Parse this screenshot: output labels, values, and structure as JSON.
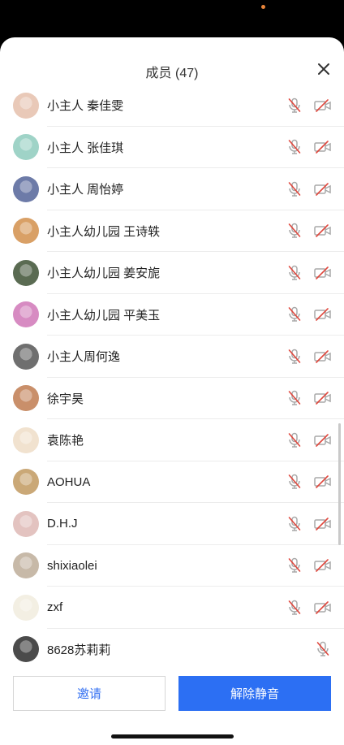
{
  "sheet": {
    "title": "成员 (47)",
    "close_icon": "close-icon"
  },
  "members": [
    {
      "name": "小主人 秦佳雯",
      "avatar_color": "#e9c9b8",
      "mic": "muted",
      "camera": "off"
    },
    {
      "name": "小主人 张佳琪",
      "avatar_color": "#9fd3c7",
      "mic": "muted",
      "camera": "off"
    },
    {
      "name": "小主人 周怡婷",
      "avatar_color": "#6d7ba8",
      "mic": "muted",
      "camera": "off"
    },
    {
      "name": "小主人幼儿园  王诗轶",
      "avatar_color": "#d9a066",
      "mic": "muted",
      "camera": "off"
    },
    {
      "name": "小主人幼儿园 姜安旎",
      "avatar_color": "#5a6b52",
      "mic": "muted",
      "camera": "off"
    },
    {
      "name": "小主人幼儿园 平美玉",
      "avatar_color": "#d78bc2",
      "mic": "muted",
      "camera": "off"
    },
    {
      "name": "小主人周何逸",
      "avatar_color": "#6f6f6f",
      "mic": "muted",
      "camera": "off"
    },
    {
      "name": "徐宇昊",
      "avatar_color": "#c98f6a",
      "mic": "muted",
      "camera": "off"
    },
    {
      "name": "袁陈艳",
      "avatar_color": "#f1e2cf",
      "mic": "muted",
      "camera": "off"
    },
    {
      "name": "AOHUA",
      "avatar_color": "#caa877",
      "mic": "muted",
      "camera": "off"
    },
    {
      "name": "D.H.J",
      "avatar_color": "#e3c3c0",
      "mic": "muted",
      "camera": "off"
    },
    {
      "name": "shixiaolei",
      "avatar_color": "#c7b9a8",
      "mic": "muted",
      "camera": "off"
    },
    {
      "name": "zxf",
      "avatar_color": "#f3efe3",
      "mic": "muted",
      "camera": "off"
    },
    {
      "name": "8628苏莉莉",
      "avatar_color": "#4b4b4b",
      "mic": "muted",
      "camera": "none"
    }
  ],
  "buttons": {
    "invite_label": "邀请",
    "unmute_label": "解除静音"
  },
  "colors": {
    "accent": "#2c6ff3",
    "muted_icon": "#e0483e",
    "icon_gray": "#a9a9a9"
  }
}
